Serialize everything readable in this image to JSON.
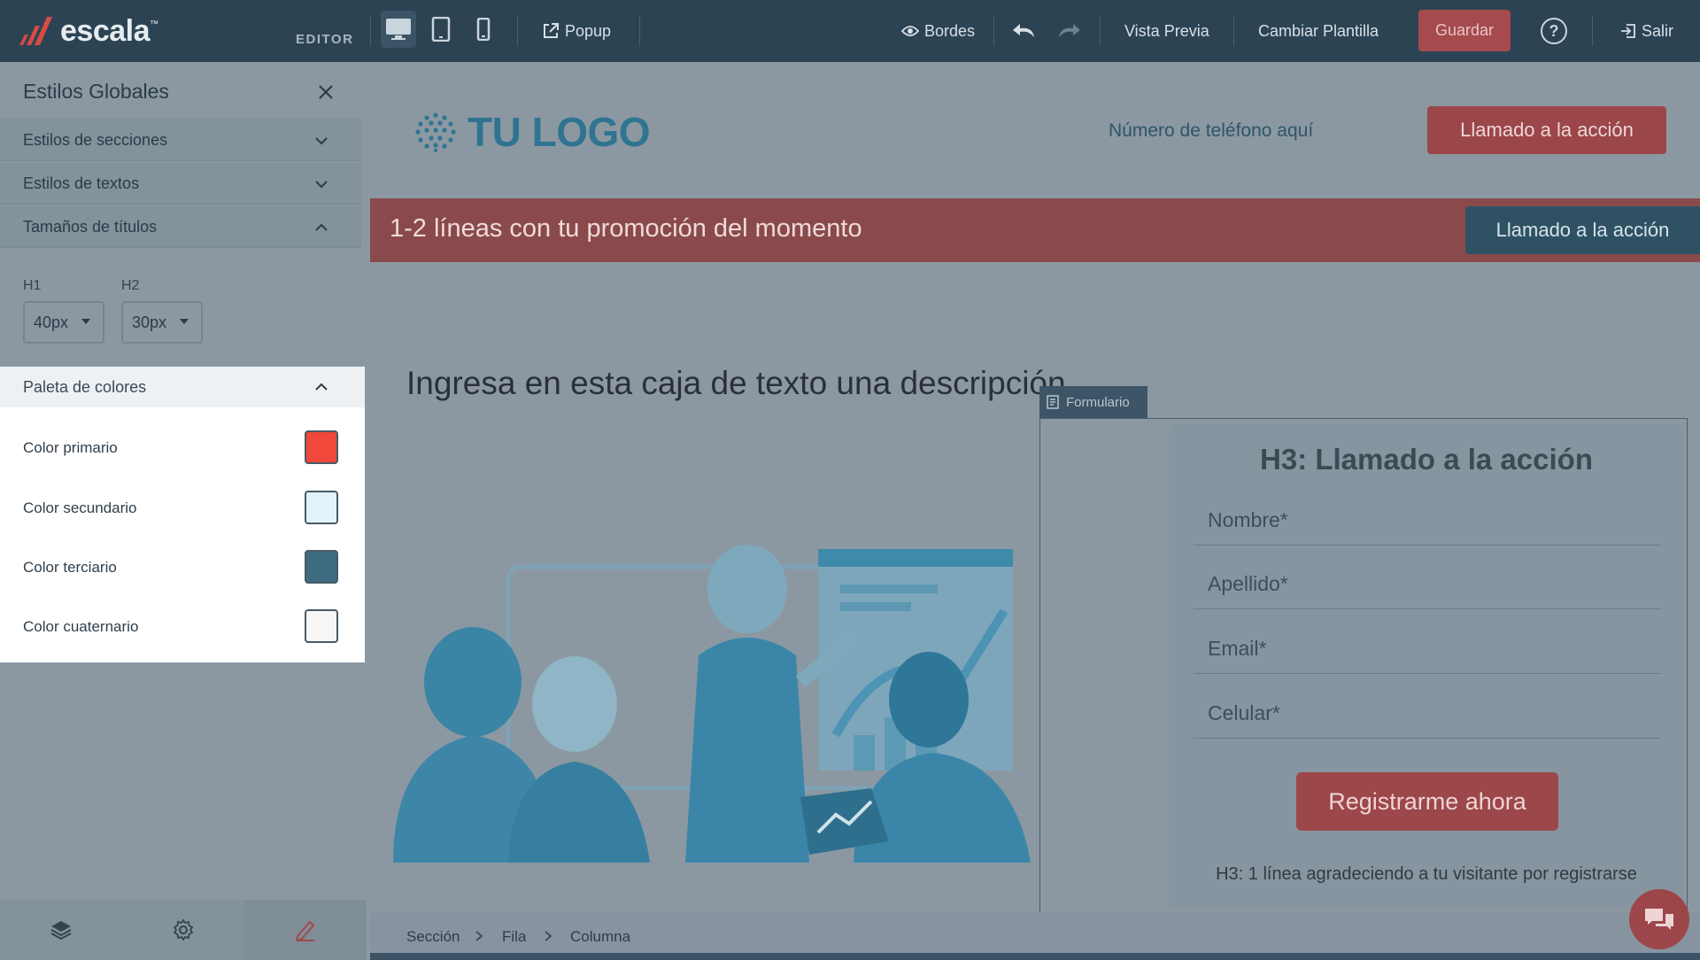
{
  "app": {
    "brand": "escala",
    "brand_tm": "™",
    "mode_label": "EDITOR"
  },
  "toolbar": {
    "popup": "Popup",
    "bordes": "Bordes",
    "vista_previa": "Vista Previa",
    "cambiar_plantilla": "Cambiar Plantilla",
    "guardar": "Guardar",
    "help": "?",
    "salir": "Salir"
  },
  "sidebar": {
    "title": "Estilos Globales",
    "sections": [
      {
        "label": "Estilos de secciones",
        "state": "collapsed"
      },
      {
        "label": "Estilos de textos",
        "state": "collapsed"
      },
      {
        "label": "Tamaños de títulos",
        "state": "expanded"
      }
    ],
    "title_sizes": {
      "h1_label": "H1",
      "h1_value": "40px",
      "h2_label": "H2",
      "h2_value": "30px"
    },
    "palette": {
      "header": "Paleta de colores",
      "colors": [
        {
          "label": "Color primario",
          "color": "#f0483a"
        },
        {
          "label": "Color secundario",
          "color": "#e2f4fa"
        },
        {
          "label": "Color terciario",
          "color": "#3f6b80"
        },
        {
          "label": "Color cuaternario",
          "color": "#f7f7f7"
        }
      ]
    }
  },
  "canvas": {
    "logo_text": "TU LOGO",
    "phone": "Número de teléfono aquí",
    "cta_top": "Llamado a la acción",
    "promo_text": "1-2 líneas con tu promoción del momento",
    "promo_cta": "Llamado a la acción",
    "description": "Ingresa en esta caja de texto una descripción",
    "form_tag": "Formulario",
    "form": {
      "title": "H3: Llamado a la acción",
      "fields": [
        "Nombre*",
        "Apellido*",
        "Email*",
        "Celular*"
      ],
      "submit": "Registrarme ahora",
      "thanks": "H3: 1 línea agradeciendo a tu visitante por registrarse"
    },
    "breadcrumb": [
      "Sección",
      "Fila",
      "Columna"
    ]
  },
  "colors": {
    "topbar": "#2c4354",
    "accent_red": "#a54a4d",
    "overlay": "#8b98a2"
  }
}
